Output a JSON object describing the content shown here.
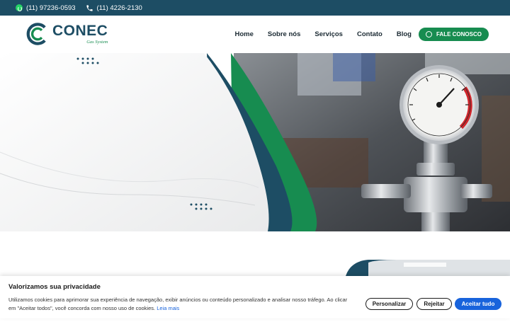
{
  "topbar": {
    "whatsapp": "(11) 97236-0593",
    "phone": "(11) 4226-2130"
  },
  "brand": {
    "name": "CONEC",
    "tagline": "Gas System"
  },
  "nav": {
    "items": [
      "Home",
      "Sobre nós",
      "Serviços",
      "Contato",
      "Blog"
    ],
    "cta": "FALE CONOSCO"
  },
  "cookie": {
    "title": "Valorizamos sua privacidade",
    "text": "Utilizamos cookies para aprimorar sua experiência de navegação, exibir anúncios ou conteúdo personalizado e analisar nosso tráfego. Ao clicar em \"Aceitar todos\", você concorda com nosso uso de cookies.",
    "link": "Leia mais",
    "buttons": {
      "customize": "Personalizar",
      "reject": "Rejeitar",
      "accept": "Aceitar tudo"
    }
  },
  "colors": {
    "primary": "#1d4d64",
    "green": "#178c50",
    "accept": "#1863dc"
  },
  "icons": {
    "whatsapp": "whatsapp-icon",
    "phone": "phone-icon"
  }
}
